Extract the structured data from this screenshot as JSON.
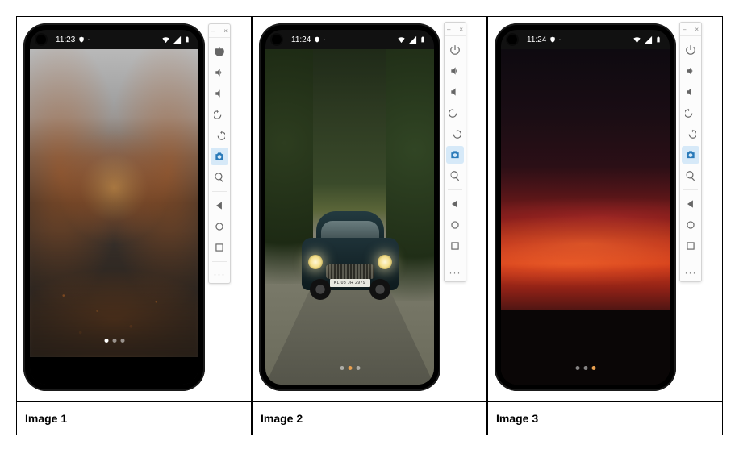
{
  "captions": [
    "Image 1",
    "Image 2",
    "Image 3"
  ],
  "emulators": [
    {
      "status": {
        "time": "11:23",
        "icons": [
          "shield-icon",
          "android-icon"
        ],
        "right": [
          "wifi-icon",
          "signal-icon",
          "battery-icon"
        ]
      },
      "pager": {
        "count": 3,
        "active_index": 0,
        "active_style": "white"
      },
      "bottom_black_strip": true,
      "plate": ""
    },
    {
      "status": {
        "time": "11:24",
        "icons": [
          "shield-icon",
          "android-icon"
        ],
        "right": [
          "wifi-icon",
          "signal-icon",
          "battery-icon"
        ]
      },
      "pager": {
        "count": 3,
        "active_index": 1,
        "active_style": "orange"
      },
      "bottom_black_strip": false,
      "plate": "KL 08 JR 2979"
    },
    {
      "status": {
        "time": "11:24",
        "icons": [
          "shield-icon",
          "android-icon"
        ],
        "right": [
          "wifi-icon",
          "signal-icon",
          "battery-icon"
        ]
      },
      "pager": {
        "count": 3,
        "active_index": 2,
        "active_style": "orange"
      },
      "bottom_black_strip": false,
      "plate": ""
    }
  ],
  "toolbar": {
    "minimize": "–",
    "close": "×",
    "buttons": [
      {
        "name": "power-icon",
        "active": false
      },
      {
        "name": "volume-up-icon",
        "active": false
      },
      {
        "name": "volume-down-icon",
        "active": false
      },
      {
        "name": "rotate-left-icon",
        "active": false
      },
      {
        "name": "rotate-right-icon",
        "active": false
      },
      {
        "name": "screenshot-icon",
        "active": true
      },
      {
        "name": "zoom-icon",
        "active": false
      },
      {
        "name": "back-icon",
        "active": false
      },
      {
        "name": "home-icon",
        "active": false
      },
      {
        "name": "overview-icon",
        "active": false
      }
    ],
    "more": "···"
  }
}
